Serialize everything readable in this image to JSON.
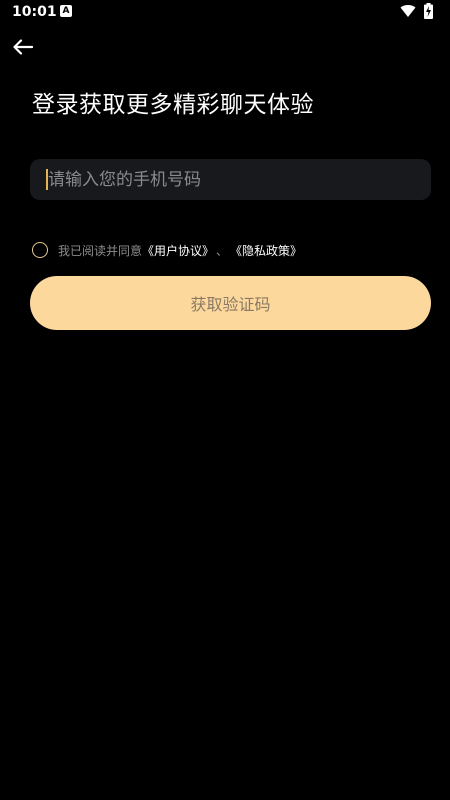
{
  "status_bar": {
    "time": "10:01",
    "app_icon_glyph": "A"
  },
  "header": {
    "back_icon": "arrow-left-icon"
  },
  "title": "登录获取更多精彩聊天体验",
  "phone": {
    "placeholder": "请输入您的手机号码",
    "value": ""
  },
  "agreement": {
    "prefix": "我已阅读并同意",
    "user_agreement": "《用户协议》",
    "separator": "、",
    "privacy_policy": "《隐私政策》",
    "checked": false
  },
  "get_code_button": {
    "label": "获取验证码"
  },
  "colors": {
    "background": "#000000",
    "input_bg": "#18191d",
    "accent": "#fdd89d",
    "cursor": "#e4b454",
    "checkbox_border": "#e6c68e",
    "muted_text": "#8c8c8c"
  }
}
